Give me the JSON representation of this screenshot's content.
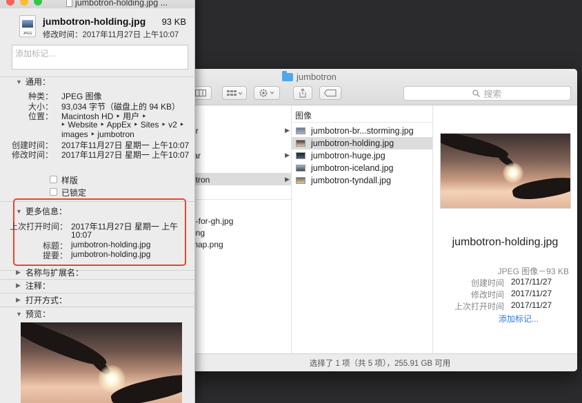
{
  "info": {
    "window_title": "jumbotron-holding.jpg ...",
    "file_icon_label": "JPEG",
    "file_name": "jumbotron-holding.jpg",
    "file_size": "93 KB",
    "modified_header": "修改时间：2017年11月27日 上午10:07",
    "tags_placeholder": "添加标记...",
    "general": {
      "title": "通用：",
      "kind_label": "种类：",
      "kind": "JPEG 图像",
      "size_label": "大小：",
      "size": "93,034 字节（磁盘上的 94 KB）",
      "where_label": "位置：",
      "where_line1": "Macintosh HD ‣ 用户 ‣",
      "where_line2": "‣ Website ‣ AppEx ‣ Sites ‣ v2 ‣",
      "where_line3": "images ‣ jumbotron",
      "created_label": "创建时间：",
      "created": "2017年11月27日 星期一 上午10:07",
      "modified_label": "修改时间：",
      "modified": "2017年11月27日 星期一 上午10:07",
      "stationery": "样版",
      "locked": "已锁定"
    },
    "more_info": {
      "title": "更多信息：",
      "last_opened_label": "上次打开时间：",
      "last_opened_line1": "2017年11月27日 星期一 上午",
      "last_opened_line2": "10:07",
      "headline_label": "标题：",
      "headline": "jumbotron-holding.jpg",
      "description_label": "提要：",
      "description": "jumbotron-holding.jpg"
    },
    "name_ext": "名称与扩展名：",
    "comments": "注释：",
    "open_with": "打开方式：",
    "preview": "预览："
  },
  "finder": {
    "title": "jumbotron",
    "search_placeholder": "搜索",
    "col1_items": [
      {
        "label": "er",
        "arrow": "▶"
      },
      {
        "label": "tar",
        "arrow": "▶"
      },
      {
        "label": "otron",
        "arrow": "▶"
      }
    ],
    "col1_files": [
      "e-for-gh.jpg",
      "ong",
      "map.png"
    ],
    "col2_header": "图像",
    "files": [
      {
        "name": "jumbotron-br...storming.jpg"
      },
      {
        "name": "jumbotron-holding.jpg"
      },
      {
        "name": "jumbotron-huge.jpg"
      },
      {
        "name": "jumbotron-iceland.jpg"
      },
      {
        "name": "jumbotron-tyndall.jpg"
      }
    ],
    "preview": {
      "name": "jumbotron-holding.jpg",
      "type": "JPEG 图像－93 KB",
      "created_label": "创建时间",
      "created": "2017/11/27",
      "modified_label": "修改时间",
      "modified": "2017/11/27",
      "last_opened_label": "上次打开时间",
      "last_opened": "2017/11/27",
      "add_tags": "添加标记..."
    },
    "status": "选择了 1 项（共 5 项），255.91 GB 可用"
  },
  "colors": {
    "highlight_box": "#e8472c",
    "link": "#2a7ae2",
    "close": "#fc5f57",
    "minimize": "#fdbc2e",
    "zoom": "#33c748"
  }
}
